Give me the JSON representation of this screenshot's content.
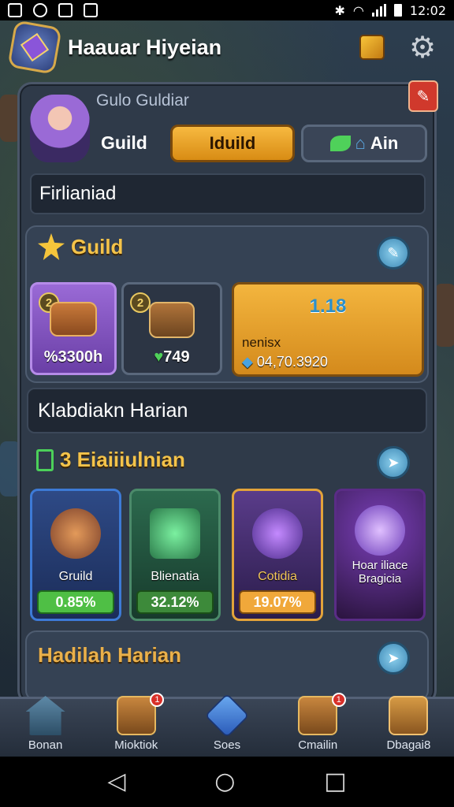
{
  "status": {
    "time": "12:02"
  },
  "header": {
    "title": "Haauar Hiyeian",
    "menu_icon": "cube-icon",
    "settings_icon": "gear-icon"
  },
  "profile": {
    "subtitle": "Gulo Guldiar",
    "guild_label": "Guild",
    "primary_tab": "Iduild",
    "secondary_tab": "Ain",
    "name_field": "Firlianiad"
  },
  "guild_section": {
    "title": "Guild",
    "cards": [
      {
        "badge": "2",
        "value": "%3300h",
        "color": "#7a4fb8"
      },
      {
        "badge": "2",
        "value": "749",
        "color": "#3b4658"
      }
    ],
    "gold_card": {
      "top": "1.18",
      "label": "nenisx",
      "value": "04,70.3920"
    }
  },
  "daily": {
    "bar_label": "Klabdiakn Harian"
  },
  "missions": {
    "title": "3 Eiaiiiulnian",
    "cards": [
      {
        "label": "Gruild",
        "value": "0.85%",
        "border": "#2d62b8"
      },
      {
        "label": "Blienatia",
        "value": "32.12%",
        "border": "#2b6f55"
      },
      {
        "label": "Cotidia",
        "value": "19.07%",
        "border": "#d18a1c"
      },
      {
        "label": "Hoar iliace Bragicia",
        "value": "",
        "border": "#5a2c86"
      }
    ]
  },
  "next_section": {
    "title": "Hadilah Harian"
  },
  "nav": [
    {
      "label": "Bonan",
      "icon": "house-icon"
    },
    {
      "label": "Mioktiok",
      "icon": "chest-icon",
      "badge": "1"
    },
    {
      "label": "Soes",
      "icon": "blue-cube-icon"
    },
    {
      "label": "Cmailin",
      "icon": "sword-icon",
      "badge": "1"
    },
    {
      "label": "Dbagai8",
      "icon": "chest-gear-icon"
    }
  ]
}
